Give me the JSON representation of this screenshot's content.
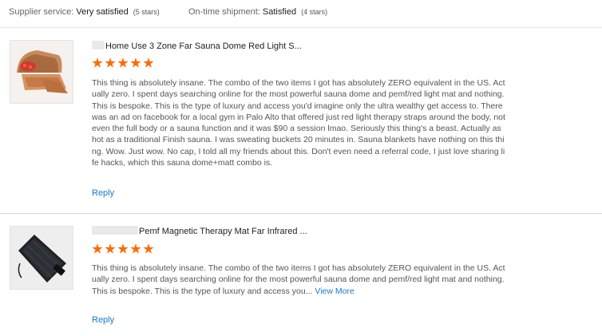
{
  "summary": {
    "supplier": {
      "label": "Supplier service: ",
      "value": "Very satisfied",
      "stars": "(5 stars)"
    },
    "shipment": {
      "label": "On-time shipment: ",
      "value": "Satisfied",
      "stars": "(4 stars)"
    }
  },
  "reviews": [
    {
      "product_title": "Home Use 3 Zone Far Sauna Dome Red Light S...",
      "rating": 5,
      "text": "This thing is absolutely insane. The combo of the two items I got has absolutely ZERO equivalent in the US. Actually zero. I spent days searching online for the most powerful sauna dome and pemf/red light mat and nothing. This is bespoke. This is the type of luxury and access you'd imagine only the ultra wealthy get access to. There was an ad on facebook for a local gym in Palo Alto that offered just red light therapy straps around the body, not even the full body or a sauna function and it was $90 a session lmao. Seriously this thing's a beast. Actually as hot as a traditional Finish sauna. I was sweating buckets 20 minutes in. Sauna blankets have nothing on this thing. Wow. Just wow. No cap, I told all my friends about this. Don't even need a referral code, I just love sharing life hacks, which this sauna dome+matt combo is.",
      "more": "",
      "reply": "Reply",
      "thumb_icon": "sauna-dome-image"
    },
    {
      "product_title": "Pemf Magnetic Therapy Mat Far Infrared ...",
      "rating": 5,
      "text": "This thing is absolutely insane. The combo of the two items I got has absolutely ZERO equivalent in the US. Actually zero. I spent days searching online for the most powerful sauna dome and pemf/red light mat and nothing. This is bespoke. This is the type of luxury and access you...",
      "more": "View More",
      "reply": "Reply",
      "thumb_icon": "therapy-mat-image"
    }
  ],
  "colors": {
    "star": "#ff6a00",
    "link": "#1a7ac7"
  }
}
